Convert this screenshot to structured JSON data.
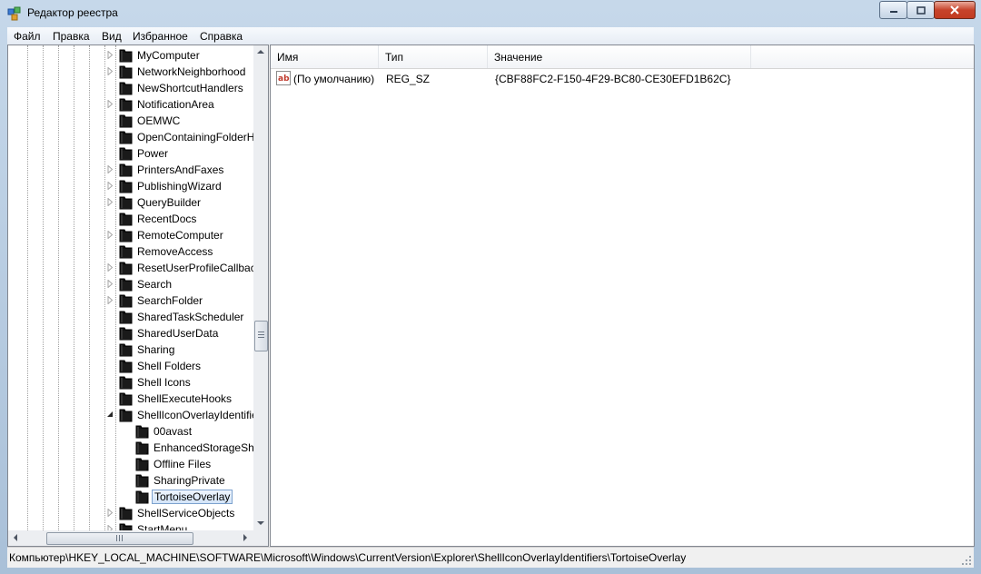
{
  "window": {
    "title": "Редактор реестра"
  },
  "menu": [
    "Файл",
    "Правка",
    "Вид",
    "Избранное",
    "Справка"
  ],
  "tree": {
    "items": [
      {
        "label": "MyComputer",
        "level": 1,
        "exp": "collapsed"
      },
      {
        "label": "NetworkNeighborhood",
        "level": 1,
        "exp": "collapsed"
      },
      {
        "label": "NewShortcutHandlers",
        "level": 1,
        "exp": "none"
      },
      {
        "label": "NotificationArea",
        "level": 1,
        "exp": "collapsed"
      },
      {
        "label": "OEMWC",
        "level": 1,
        "exp": "none"
      },
      {
        "label": "OpenContainingFolderHiddenList",
        "level": 1,
        "exp": "none"
      },
      {
        "label": "Power",
        "level": 1,
        "exp": "none"
      },
      {
        "label": "PrintersAndFaxes",
        "level": 1,
        "exp": "collapsed"
      },
      {
        "label": "PublishingWizard",
        "level": 1,
        "exp": "collapsed"
      },
      {
        "label": "QueryBuilder",
        "level": 1,
        "exp": "collapsed"
      },
      {
        "label": "RecentDocs",
        "level": 1,
        "exp": "none"
      },
      {
        "label": "RemoteComputer",
        "level": 1,
        "exp": "collapsed"
      },
      {
        "label": "RemoveAccess",
        "level": 1,
        "exp": "none"
      },
      {
        "label": "ResetUserProfileCallbacks",
        "level": 1,
        "exp": "collapsed"
      },
      {
        "label": "Search",
        "level": 1,
        "exp": "collapsed"
      },
      {
        "label": "SearchFolder",
        "level": 1,
        "exp": "collapsed"
      },
      {
        "label": "SharedTaskScheduler",
        "level": 1,
        "exp": "none"
      },
      {
        "label": "SharedUserData",
        "level": 1,
        "exp": "none"
      },
      {
        "label": "Sharing",
        "level": 1,
        "exp": "none"
      },
      {
        "label": "Shell Folders",
        "level": 1,
        "exp": "none"
      },
      {
        "label": "Shell Icons",
        "level": 1,
        "exp": "none"
      },
      {
        "label": "ShellExecuteHooks",
        "level": 1,
        "exp": "none"
      },
      {
        "label": "ShellIconOverlayIdentifiers",
        "level": 1,
        "exp": "expanded"
      },
      {
        "label": "00avast",
        "level": 2,
        "exp": "none"
      },
      {
        "label": "EnhancedStorageShell",
        "level": 2,
        "exp": "none"
      },
      {
        "label": "Offline Files",
        "level": 2,
        "exp": "none"
      },
      {
        "label": "SharingPrivate",
        "level": 2,
        "exp": "none"
      },
      {
        "label": "TortoiseOverlay",
        "level": 2,
        "exp": "none",
        "selected": true
      },
      {
        "label": "ShellServiceObjects",
        "level": 1,
        "exp": "collapsed"
      },
      {
        "label": "StartMenu",
        "level": 1,
        "exp": "collapsed"
      }
    ]
  },
  "list": {
    "columns": [
      "Имя",
      "Тип",
      "Значение"
    ],
    "rows": [
      {
        "name": "(По умолчанию)",
        "type": "REG_SZ",
        "value": "{CBF88FC2-F150-4F29-BC80-CE30EFD1B62C}",
        "icon": "string-value-icon"
      }
    ]
  },
  "status": {
    "path": "Компьютер\\HKEY_LOCAL_MACHINE\\SOFTWARE\\Microsoft\\Windows\\CurrentVersion\\Explorer\\ShellIconOverlayIdentifiers\\TortoiseOverlay"
  },
  "colors": {
    "selection_border": "#7da2ce",
    "title_gradient_top": "#c6d8ea",
    "close_button": "#c7432b"
  }
}
